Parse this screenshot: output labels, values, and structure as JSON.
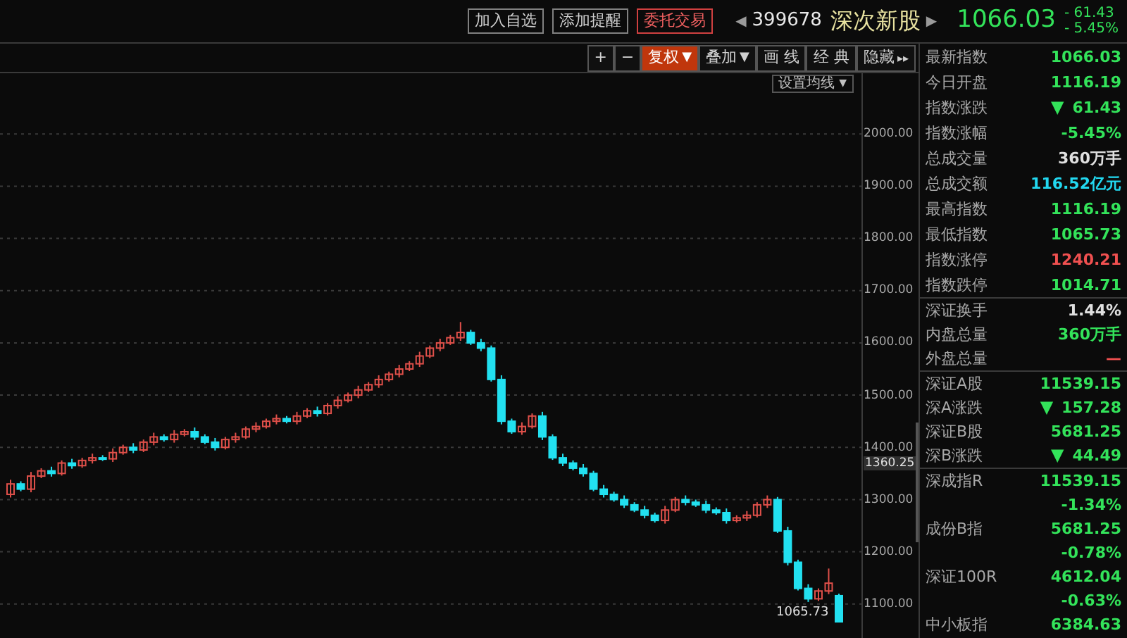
{
  "header": {
    "buttons": [
      {
        "label": "加入自选",
        "kind": "plain"
      },
      {
        "label": "添加提醒",
        "kind": "plain"
      },
      {
        "label": "委托交易",
        "kind": "trade"
      }
    ],
    "prev_icon": "◀",
    "code": "399678",
    "name": "深次新股",
    "next_icon": "▶",
    "price": "1066.03",
    "change": "- 61.43",
    "change_pct": "- 5.45%"
  },
  "toolbar": [
    {
      "label": "+",
      "kind": "plain",
      "selected": false
    },
    {
      "label": "−",
      "kind": "plain",
      "selected": false
    },
    {
      "label": "复权",
      "kind": "dropdown",
      "caret": "▼",
      "selected": true
    },
    {
      "label": "叠加",
      "kind": "dropdown",
      "caret": "▼",
      "selected": false
    },
    {
      "label": "画 线",
      "kind": "plain",
      "selected": false
    },
    {
      "label": "经 典",
      "kind": "plain",
      "selected": false
    },
    {
      "label": "隐藏",
      "kind": "expand",
      "caret": "▸▸",
      "selected": false
    }
  ],
  "ma_button": {
    "label": "设置均线",
    "caret": "▼"
  },
  "chart": {
    "crosshair_price": "1360.25",
    "low_label": "1065.73",
    "chart_data": {
      "type": "candlestick",
      "ylim": [
        1035,
        2119
      ],
      "grid": true,
      "yticks": [
        {
          "value": 2000,
          "label": "2000.00"
        },
        {
          "value": 1900,
          "label": "1900.00"
        },
        {
          "value": 1800,
          "label": "1800.00"
        },
        {
          "value": 1700,
          "label": "1700.00"
        },
        {
          "value": 1600,
          "label": "1600.00"
        },
        {
          "value": 1500,
          "label": "1500.00"
        },
        {
          "value": 1400,
          "label": "1400.00"
        },
        {
          "value": 1300,
          "label": "1300.00"
        },
        {
          "value": 1200,
          "label": "1200.00"
        },
        {
          "value": 1100,
          "label": "1100.00"
        }
      ],
      "ohlc": [
        [
          1310,
          1338,
          1304,
          1330
        ],
        [
          1330,
          1335,
          1316,
          1320
        ],
        [
          1320,
          1353,
          1314,
          1345
        ],
        [
          1345,
          1360,
          1341,
          1355
        ],
        [
          1355,
          1363,
          1344,
          1350
        ],
        [
          1350,
          1375,
          1346,
          1370
        ],
        [
          1370,
          1378,
          1359,
          1365
        ],
        [
          1365,
          1380,
          1361,
          1375
        ],
        [
          1375,
          1388,
          1369,
          1380
        ],
        [
          1380,
          1385,
          1374,
          1378
        ],
        [
          1378,
          1398,
          1372,
          1390
        ],
        [
          1390,
          1405,
          1386,
          1400
        ],
        [
          1400,
          1408,
          1389,
          1395
        ],
        [
          1395,
          1415,
          1391,
          1410
        ],
        [
          1410,
          1428,
          1404,
          1420
        ],
        [
          1420,
          1425,
          1411,
          1415
        ],
        [
          1415,
          1433,
          1409,
          1425
        ],
        [
          1425,
          1435,
          1421,
          1430
        ],
        [
          1430,
          1438,
          1414,
          1420
        ],
        [
          1420,
          1425,
          1406,
          1410
        ],
        [
          1410,
          1418,
          1394,
          1400
        ],
        [
          1400,
          1420,
          1396,
          1415
        ],
        [
          1415,
          1428,
          1409,
          1420
        ],
        [
          1420,
          1440,
          1416,
          1435
        ],
        [
          1435,
          1448,
          1429,
          1440
        ],
        [
          1440,
          1455,
          1436,
          1450
        ],
        [
          1450,
          1463,
          1444,
          1455
        ],
        [
          1455,
          1460,
          1446,
          1450
        ],
        [
          1450,
          1468,
          1444,
          1460
        ],
        [
          1460,
          1475,
          1456,
          1470
        ],
        [
          1470,
          1478,
          1459,
          1465
        ],
        [
          1465,
          1485,
          1461,
          1480
        ],
        [
          1480,
          1498,
          1474,
          1490
        ],
        [
          1490,
          1505,
          1486,
          1500
        ],
        [
          1500,
          1518,
          1494,
          1510
        ],
        [
          1510,
          1525,
          1506,
          1520
        ],
        [
          1520,
          1538,
          1514,
          1530
        ],
        [
          1530,
          1545,
          1526,
          1540
        ],
        [
          1540,
          1558,
          1534,
          1550
        ],
        [
          1550,
          1565,
          1546,
          1560
        ],
        [
          1560,
          1583,
          1554,
          1575
        ],
        [
          1575,
          1595,
          1571,
          1590
        ],
        [
          1590,
          1608,
          1584,
          1600
        ],
        [
          1600,
          1615,
          1596,
          1610
        ],
        [
          1610,
          1640,
          1604,
          1620
        ],
        [
          1620,
          1625,
          1596,
          1600
        ],
        [
          1600,
          1608,
          1584,
          1590
        ],
        [
          1590,
          1595,
          1526,
          1530
        ],
        [
          1530,
          1538,
          1444,
          1450
        ],
        [
          1450,
          1455,
          1426,
          1430
        ],
        [
          1430,
          1448,
          1424,
          1440
        ],
        [
          1440,
          1465,
          1436,
          1460
        ],
        [
          1460,
          1468,
          1414,
          1420
        ],
        [
          1420,
          1425,
          1376,
          1380
        ],
        [
          1380,
          1388,
          1364,
          1370
        ],
        [
          1370,
          1375,
          1356,
          1360
        ],
        [
          1360,
          1368,
          1344,
          1350
        ],
        [
          1350,
          1355,
          1316,
          1320
        ],
        [
          1320,
          1328,
          1304,
          1310
        ],
        [
          1310,
          1315,
          1296,
          1300
        ],
        [
          1300,
          1308,
          1284,
          1290
        ],
        [
          1290,
          1295,
          1276,
          1280
        ],
        [
          1280,
          1288,
          1264,
          1270
        ],
        [
          1270,
          1275,
          1256,
          1260
        ],
        [
          1260,
          1288,
          1254,
          1280
        ],
        [
          1280,
          1305,
          1276,
          1300
        ],
        [
          1300,
          1308,
          1289,
          1295
        ],
        [
          1295,
          1300,
          1286,
          1290
        ],
        [
          1290,
          1298,
          1274,
          1280
        ],
        [
          1280,
          1285,
          1271,
          1275
        ],
        [
          1275,
          1283,
          1254,
          1260
        ],
        [
          1260,
          1270,
          1256,
          1265
        ],
        [
          1265,
          1278,
          1259,
          1270
        ],
        [
          1270,
          1295,
          1266,
          1290
        ],
        [
          1290,
          1308,
          1284,
          1300
        ],
        [
          1300,
          1305,
          1236,
          1240
        ],
        [
          1240,
          1248,
          1174,
          1180
        ],
        [
          1180,
          1185,
          1126,
          1130
        ],
        [
          1130,
          1138,
          1104,
          1110
        ],
        [
          1110,
          1130,
          1106,
          1125
        ],
        [
          1125,
          1168,
          1119,
          1140
        ],
        [
          1116,
          1120,
          1066,
          1066
        ]
      ]
    }
  },
  "quote_sections": [
    [
      {
        "label": "最新指数",
        "value": "1066.03",
        "color": "#33e35a"
      },
      {
        "label": "今日开盘",
        "value": "1116.19",
        "color": "#33e35a"
      },
      {
        "label": "指数涨跌",
        "value": "61.43",
        "color": "#33e35a",
        "arrow": "▼"
      },
      {
        "label": "指数涨幅",
        "value": "-5.45%",
        "color": "#33e35a"
      },
      {
        "label": "总成交量",
        "value": "360万手",
        "color": "#e0e0e0"
      },
      {
        "label": "总成交额",
        "value": "116.52亿元",
        "color": "#22d8f0"
      },
      {
        "label": "最高指数",
        "value": "1116.19",
        "color": "#33e35a"
      },
      {
        "label": "最低指数",
        "value": "1065.73",
        "color": "#33e35a"
      },
      {
        "label": "指数涨停",
        "value": "1240.21",
        "color": "#f05050"
      },
      {
        "label": "指数跌停",
        "value": "1014.71",
        "color": "#33e35a"
      }
    ],
    [
      {
        "label": "深证换手",
        "value": "1.44%",
        "color": "#e0e0e0"
      },
      {
        "label": "内盘总量",
        "value": "360万手",
        "color": "#33e35a"
      },
      {
        "label": "外盘总量",
        "value": "—",
        "color": "#f05050"
      }
    ],
    [
      {
        "label": "深证A股",
        "value": "11539.15",
        "color": "#33e35a"
      },
      {
        "label": "深A涨跌",
        "value": "157.28",
        "color": "#33e35a",
        "arrow": "▼"
      },
      {
        "label": "深证B股",
        "value": "5681.25",
        "color": "#33e35a"
      },
      {
        "label": "深B涨跌",
        "value": "44.49",
        "color": "#33e35a",
        "arrow": "▼"
      }
    ],
    [
      {
        "label": "深成指R",
        "value": "11539.15",
        "color": "#33e35a"
      },
      {
        "value": "-1.34%",
        "color": "#33e35a"
      },
      {
        "label": "成份B指",
        "value": "5681.25",
        "color": "#33e35a"
      },
      {
        "value": "-0.78%",
        "color": "#33e35a"
      },
      {
        "label": "深证100R",
        "value": "4612.04",
        "color": "#33e35a"
      },
      {
        "value": "-0.63%",
        "color": "#33e35a"
      },
      {
        "label": "中小板指",
        "value": "6384.63",
        "color": "#33e35a"
      }
    ]
  ]
}
